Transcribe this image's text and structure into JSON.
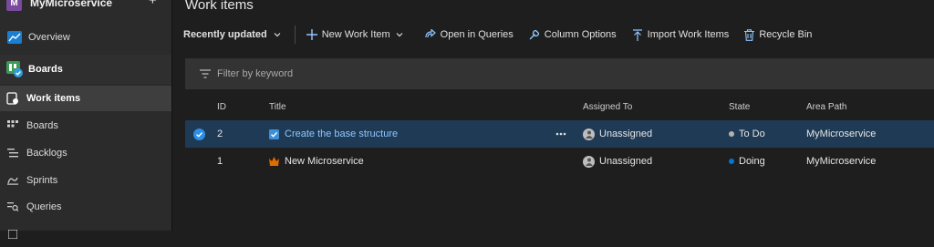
{
  "project": {
    "initial": "M",
    "name": "MyMicroservice"
  },
  "nav": {
    "overview": "Overview",
    "boards_group": "Boards",
    "work_items": "Work items",
    "boards": "Boards",
    "backlogs": "Backlogs",
    "sprints": "Sprints",
    "queries": "Queries"
  },
  "page": {
    "title": "Work items"
  },
  "toolbar": {
    "view": "Recently updated",
    "new_item": "New Work Item",
    "open_queries": "Open in Queries",
    "column_options": "Column Options",
    "import": "Import Work Items",
    "recycle": "Recycle Bin"
  },
  "filter": {
    "placeholder": "Filter by keyword"
  },
  "columns": {
    "id": "ID",
    "title": "Title",
    "assigned": "Assigned To",
    "state": "State",
    "area": "Area Path"
  },
  "rows": [
    {
      "id": "2",
      "title": "Create the base structure",
      "assigned": "Unassigned",
      "state": "To Do",
      "area": "MyMicroservice",
      "state_color": "#b2b2b2",
      "type_icon": "task-icon"
    },
    {
      "id": "1",
      "title": "New Microservice",
      "assigned": "Unassigned",
      "state": "Doing",
      "area": "MyMicroservice",
      "state_color": "#0078d4",
      "type_icon": "epic-crown-icon"
    }
  ],
  "colors": {
    "accent": "#0078d4",
    "selected_row": "#1f3a55",
    "epic": "#e06c00",
    "link": "#8fc7ff"
  }
}
